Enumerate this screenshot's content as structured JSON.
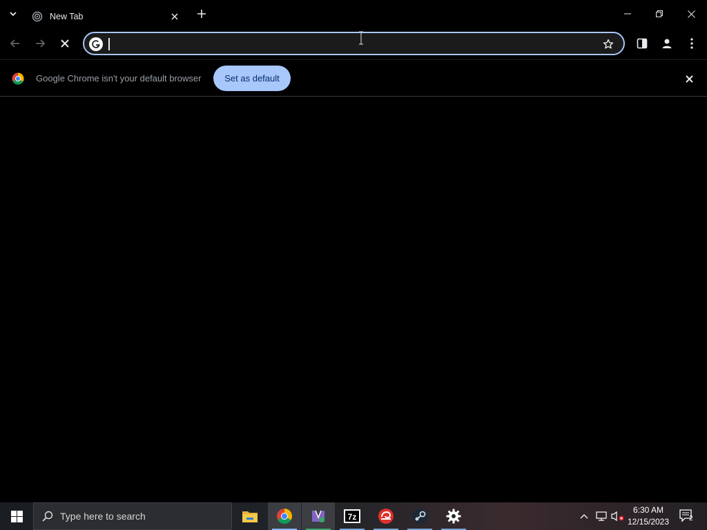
{
  "tabs": [
    {
      "title": "New Tab"
    }
  ],
  "omnibox": {
    "value": "",
    "placeholder": ""
  },
  "infobar": {
    "message": "Google Chrome isn't your default browser",
    "button_label": "Set as default"
  },
  "taskbar": {
    "search_placeholder": "Type here to search",
    "apps": [
      "file-explorer-icon",
      "chrome-icon",
      "visual-studio-installer-icon",
      "7zip-icon",
      "game-launcher-icon",
      "steam-icon",
      "settings-icon"
    ],
    "time": "6:30 AM",
    "date": "12/15/2023",
    "notification_count": "2"
  },
  "colors": {
    "accent": "#a8c7fa",
    "background": "#000000"
  }
}
